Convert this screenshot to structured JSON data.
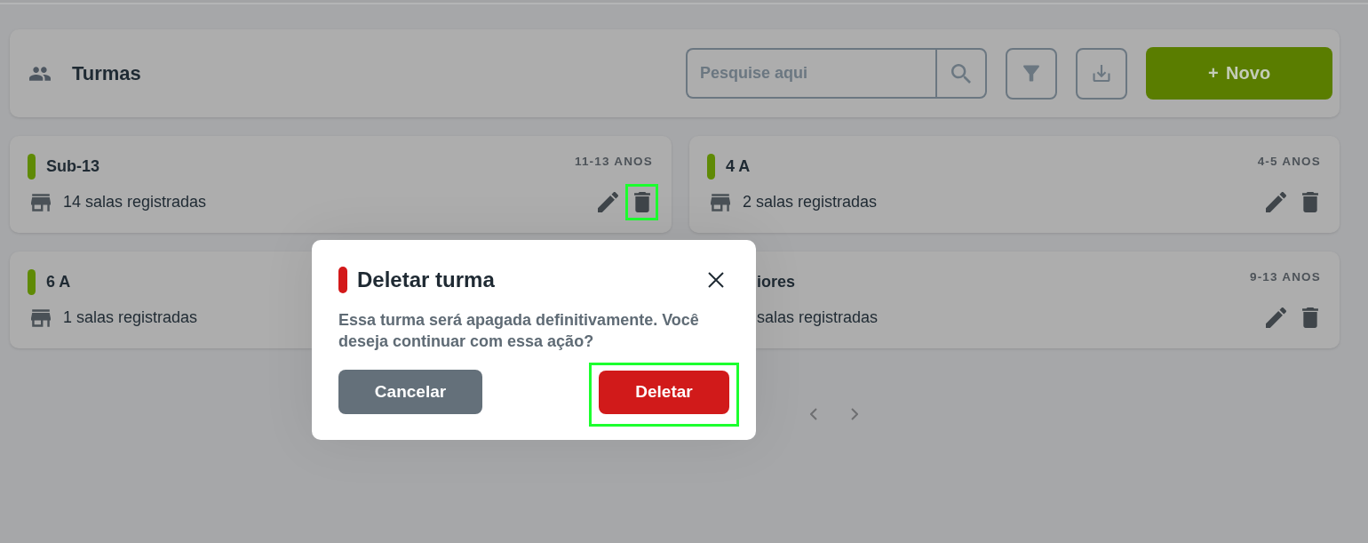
{
  "header": {
    "title": "Turmas",
    "search": {
      "placeholder": "Pesquise aqui"
    },
    "new_button": {
      "label": "+ Novo"
    }
  },
  "cards": [
    {
      "kind": "full",
      "title": "Sub-13",
      "age": "11-13 ANOS",
      "rooms": "14 salas registradas",
      "delete_highlighted": true
    },
    {
      "kind": "full",
      "title": "4 A",
      "age": "4-5 ANOS",
      "rooms": "2 salas registradas",
      "delete_highlighted": false
    },
    {
      "kind": "cut-right",
      "title": "6 A",
      "rooms": "1 salas registradas"
    },
    {
      "kind": "cut-left",
      "title": "iores",
      "age": "9-13 ANOS",
      "rooms": "salas registradas",
      "delete_highlighted": false
    }
  ],
  "dialog": {
    "title": "Deletar turma",
    "message": "Essa turma será apagada definitivamente. Você deseja continuar com essa ação?",
    "buttons": [
      {
        "kind": "cancel",
        "label": "Cancelar",
        "highlighted": false
      },
      {
        "kind": "confirm",
        "label": "Deletar",
        "highlighted": true
      }
    ]
  }
}
